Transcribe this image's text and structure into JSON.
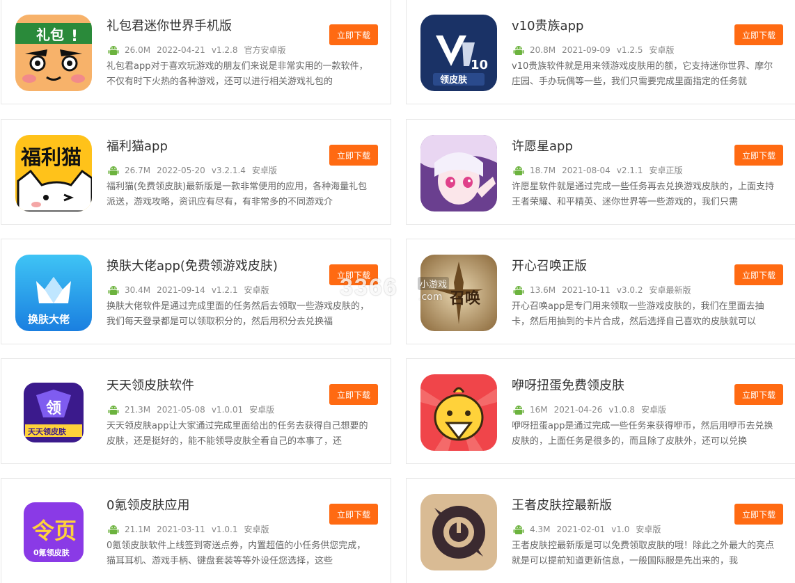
{
  "button_label": "立即下载",
  "accent_color": "#ff6a12",
  "watermark": {
    "number": "3366",
    "small": "小游戏",
    "domain": ".com"
  },
  "apps": [
    {
      "title": "礼包君迷你世界手机版",
      "size": "26.0M",
      "date": "2022-04-21",
      "version": "v1.2.8",
      "tag": "官方安卓版",
      "desc": "礼包君app对于喜欢玩游戏的朋友们来说是非常实用的一款软件，不仅有时下火热的各种游戏，还可以进行相关游戏礼包的",
      "icon": "libaojun-icon",
      "icon_text": "礼包"
    },
    {
      "title": "v10贵族app",
      "size": "20.8M",
      "date": "2021-09-09",
      "version": "v1.2.5",
      "tag": "安卓版",
      "desc": "v10贵族软件就是用来领游戏皮肤用的额，它支持迷你世界、摩尔庄园、手办玩偶等一些，我们只需要完成里面指定的任务就",
      "icon": "v10-icon",
      "icon_text": "领皮肤"
    },
    {
      "title": "福利猫app",
      "size": "26.7M",
      "date": "2022-05-20",
      "version": "v3.2.1.4",
      "tag": "安卓版",
      "desc": "福利猫(免费领皮肤)最新版是一款非常便用的应用，各种海量礼包派送，游戏攻略，资讯应有尽有，有非常多的不同游戏介",
      "icon": "fulimao-icon",
      "icon_text": "福利猫"
    },
    {
      "title": "许愿星app",
      "size": "18.7M",
      "date": "2021-08-04",
      "version": "v2.1.1",
      "tag": "安卓正版",
      "desc": "许愿星软件就是通过完成一些任务再去兑换游戏皮肤的，上面支持王者荣耀、和平精英、迷你世界等一些游戏的，我们只需",
      "icon": "xuyuanxing-icon",
      "icon_text": ""
    },
    {
      "title": "换肤大佬app(免费领游戏皮肤)",
      "size": "30.4M",
      "date": "2021-09-14",
      "version": "v1.2.1",
      "tag": "安卓版",
      "desc": "换肤大佬软件是通过完成里面的任务然后去领取一些游戏皮肤的，我们每天登录都是可以领取积分的，然后用积分去兑换福",
      "icon": "huanfudalao-icon",
      "icon_text": "换肤大佬"
    },
    {
      "title": "开心召唤正版",
      "size": "13.6M",
      "date": "2021-10-11",
      "version": "v3.0.2",
      "tag": "安卓最新版",
      "desc": "开心召唤app是专门用来领取一些游戏皮肤的，我们在里面去抽卡，然后用抽到的卡片合成，然后选择自己喜欢的皮肤就可以",
      "icon": "kaixinzhaohuan-icon",
      "icon_text": "召唤"
    },
    {
      "title": "天天领皮肤软件",
      "size": "21.3M",
      "date": "2021-05-08",
      "version": "v1.0.01",
      "tag": "安卓版",
      "desc": "天天领皮肤app让大家通过完成里面给出的任务去获得自己想要的皮肤，还是挺好的，能不能领导皮肤全看自己的本事了，还",
      "icon": "tiantianling-icon",
      "icon_text": "天天领皮肤"
    },
    {
      "title": "咿呀扭蛋免费领皮肤",
      "size": "16M",
      "date": "2021-04-26",
      "version": "v1.0.8",
      "tag": "安卓版",
      "desc": "咿呀扭蛋app是通过完成一些任务来获得咿币，然后用咿币去兑换皮肤的，上面任务是很多的，而且除了皮肤外，还可以兑换",
      "icon": "yiyaniudan-icon",
      "icon_text": ""
    },
    {
      "title": "0氪领皮肤应用",
      "size": "21.1M",
      "date": "2021-03-11",
      "version": "v1.0.1",
      "tag": "安卓版",
      "desc": "0氪领皮肤软件上线签到寄送点券，内置超值的小任务供您完成，猫耳耳机、游戏手柄、键盘套装等等外设任您选择，这些",
      "icon": "0ke-icon",
      "icon_text": "0氪领皮肤"
    },
    {
      "title": "王者皮肤控最新版",
      "size": "4.3M",
      "date": "2021-02-01",
      "version": "v1.0",
      "tag": "安卓版",
      "desc": "王者皮肤控最新版是可以免费领取皮肤的哦！除此之外最大的亮点就是可以提前知道更新信息，一般国际服是先出来的，我",
      "icon": "wangzhepifukong-icon",
      "icon_text": ""
    }
  ]
}
